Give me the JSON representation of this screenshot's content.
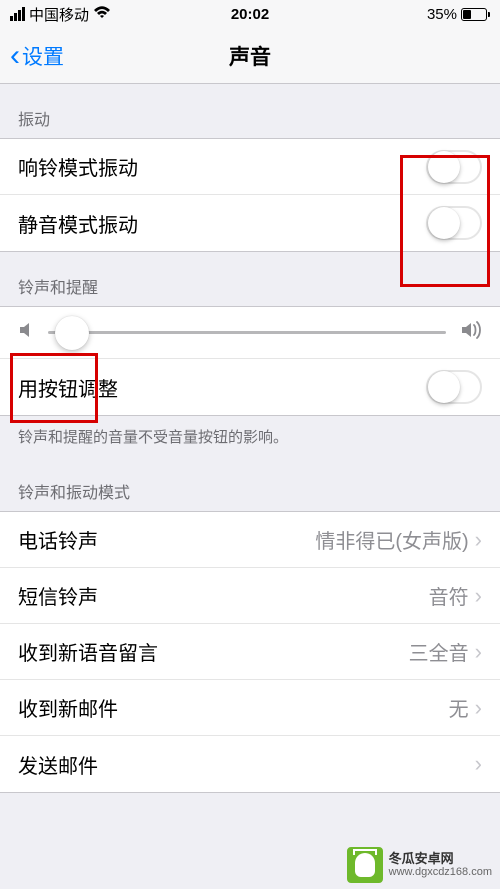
{
  "status": {
    "carrier": "中国移动",
    "time": "20:02",
    "battery_pct": "35%"
  },
  "nav": {
    "back": "设置",
    "title": "声音"
  },
  "sections": {
    "vibration": {
      "header": "振动",
      "ring": "响铃模式振动",
      "silent": "静音模式振动"
    },
    "ringer": {
      "header": "铃声和提醒",
      "button_adjust": "用按钮调整",
      "footnote": "铃声和提醒的音量不受音量按钮的影响。"
    },
    "sounds": {
      "header": "铃声和振动模式",
      "items": [
        {
          "label": "电话铃声",
          "value": "情非得已(女声版)"
        },
        {
          "label": "短信铃声",
          "value": "音符"
        },
        {
          "label": "收到新语音留言",
          "value": "三全音"
        },
        {
          "label": "收到新邮件",
          "value": "无"
        },
        {
          "label": "发送邮件",
          "value": ""
        }
      ]
    }
  },
  "watermark": {
    "name": "冬瓜安卓网",
    "url": "www.dgxcdz168.com"
  }
}
